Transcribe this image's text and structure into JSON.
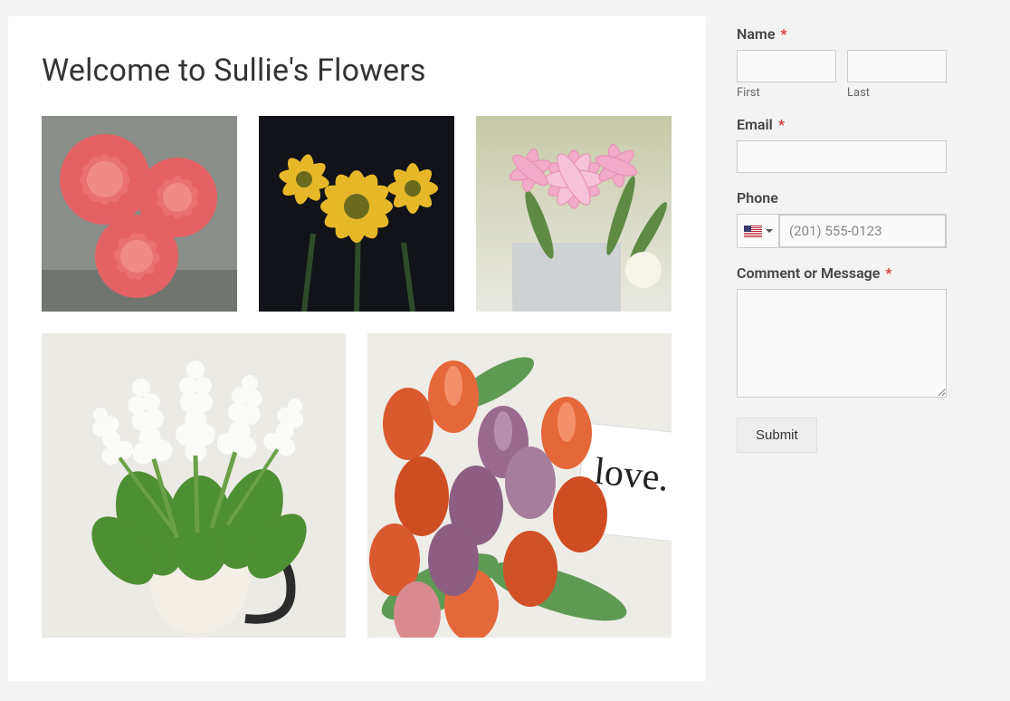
{
  "main": {
    "heading": "Welcome to Sullie's Flowers",
    "gallery": {
      "row1": [
        "pink-dahlias",
        "yellow-daisies",
        "pink-lilies"
      ],
      "row2": [
        "white-stock-in-pitcher",
        "orange-purple-tulips"
      ]
    }
  },
  "form": {
    "name": {
      "label": "Name",
      "required": "*",
      "first_sublabel": "First",
      "last_sublabel": "Last",
      "first_value": "",
      "last_value": ""
    },
    "email": {
      "label": "Email",
      "required": "*",
      "value": ""
    },
    "phone": {
      "label": "Phone",
      "country": "US",
      "placeholder": "(201) 555-0123",
      "value": ""
    },
    "comment": {
      "label": "Comment or Message",
      "required": "*",
      "value": ""
    },
    "submit_label": "Submit"
  }
}
